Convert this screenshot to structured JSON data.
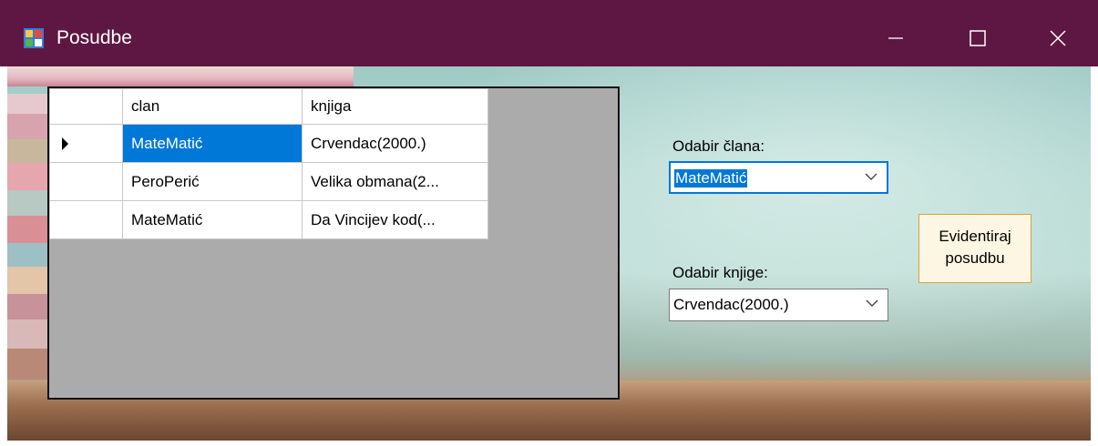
{
  "window": {
    "title": "Posudbe",
    "icon": "app-form-icon",
    "controls": [
      "minimize-icon",
      "maximize-icon",
      "close-icon"
    ]
  },
  "grid": {
    "columns": [
      "clan",
      "knjiga"
    ],
    "rows": [
      {
        "clan": "MateMatić",
        "knjiga": "Crvendac(2000.)",
        "current": true
      },
      {
        "clan": "PeroPerić",
        "knjiga": "Velika obmana(2..."
      },
      {
        "clan": "MateMatić",
        "knjiga": "Da Vincijev kod(..."
      }
    ],
    "selected_row": 0
  },
  "member": {
    "label": "Odabir člana:",
    "value": "MateMatić"
  },
  "book": {
    "label": "Odabir knjige:",
    "value": "Crvendac(2000.)"
  },
  "action": {
    "line1": "Evidentiraj",
    "line2": "posudbu"
  },
  "colors": {
    "titlebar": "#5e1742",
    "selection": "#0078d7",
    "grid_background": "#ababab",
    "button_border": "#d6a53a"
  }
}
